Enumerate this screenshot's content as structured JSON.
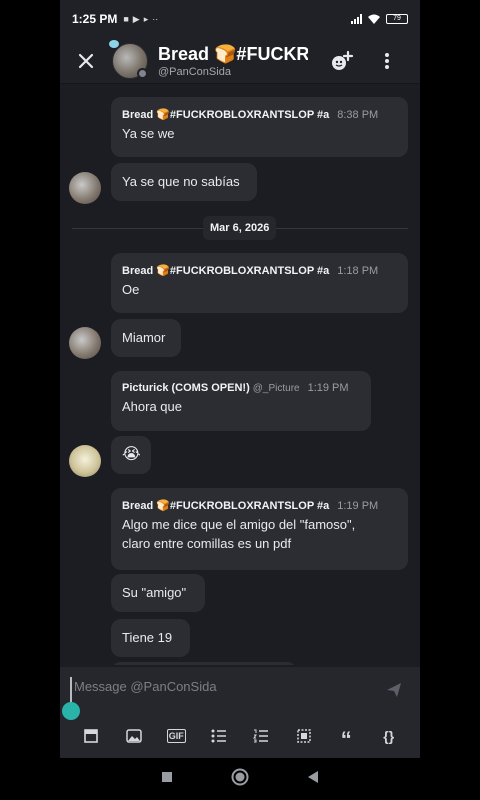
{
  "status_bar": {
    "time": "1:25 PM",
    "battery": "79"
  },
  "header": {
    "title": "Bread 🍞#FUCKR",
    "subtitle": "@PanConSida"
  },
  "messages": [
    {
      "author": "Bread 🍞#FUCKROBLOXRANTSLOP #a",
      "time": "8:38 PM",
      "text": "Ya se we"
    },
    {
      "text": "Ya se que no sabías"
    },
    {
      "author": "Bread 🍞#FUCKROBLOXRANTSLOP #a",
      "time": "1:18 PM",
      "text": "Oe"
    },
    {
      "text": "Miamor"
    },
    {
      "author": "Picturick (COMS OPEN!)",
      "tag": "@_Picture",
      "time": "1:19 PM",
      "text": "Ahora que"
    },
    {
      "text": "😭"
    },
    {
      "author": "Bread 🍞#FUCKROBLOXRANTSLOP #a",
      "time": "1:19 PM",
      "text_line1": "Algo me dice que el amigo del \"famoso\",",
      "text_line2": "claro entre comillas es un pdf"
    },
    {
      "text": "Su \"amigo\""
    },
    {
      "text": "Tiene 19"
    }
  ],
  "date_divider": "Mar 6, 2026",
  "composer": {
    "placeholder": "Message @PanConSida"
  },
  "toolbar": [
    {
      "name": "bold-block-tool",
      "glyph": "▣"
    },
    {
      "name": "image-tool",
      "glyph": ""
    },
    {
      "name": "gif-tool",
      "glyph": "GIF"
    },
    {
      "name": "bullet-list-tool",
      "glyph": ""
    },
    {
      "name": "numbered-list-tool",
      "glyph": ""
    },
    {
      "name": "spoiler-tool",
      "glyph": ""
    },
    {
      "name": "quote-tool",
      "glyph": "“"
    },
    {
      "name": "code-block-tool",
      "glyph": "{}"
    }
  ],
  "colors": {
    "background": "#1c1d22",
    "bubble": "#2b2d33",
    "accent": "#2ab3a8"
  }
}
